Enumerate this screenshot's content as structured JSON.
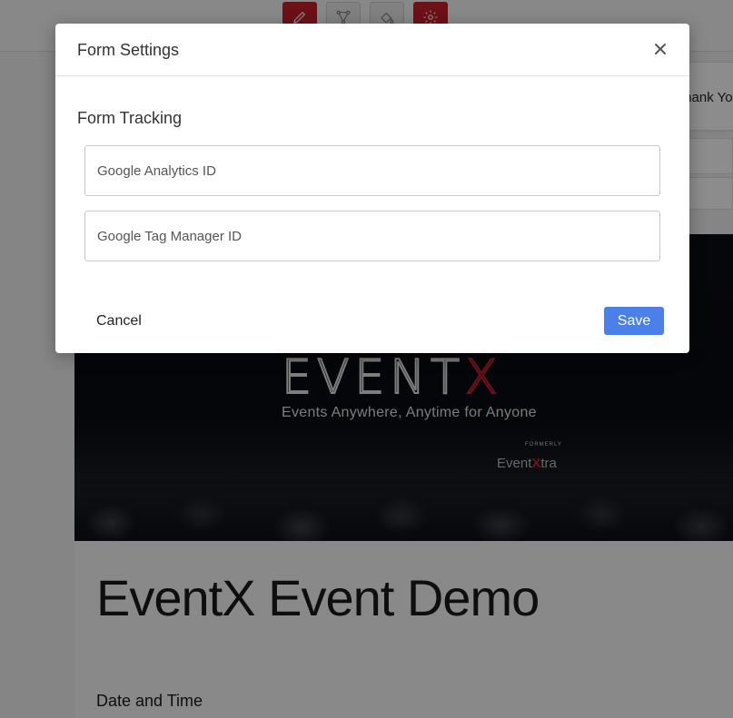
{
  "toolbar": {
    "tools": [
      {
        "icon": "pencil-icon",
        "active": true
      },
      {
        "icon": "flow-icon",
        "active": false
      },
      {
        "icon": "paint-bucket-icon",
        "active": false
      },
      {
        "icon": "gear-icon",
        "active": true
      }
    ],
    "accent_color": "#c4202b"
  },
  "side_tab": {
    "label": "Thank You"
  },
  "banner": {
    "logo_text": "EVENTX",
    "tagline": "Events Anywhere, Anytime for Anyone",
    "formerly_label": "FORMERLY",
    "formerly_logo": "EventXtra"
  },
  "page": {
    "event_title": "EventX Event Demo",
    "date_label": "Date and Time"
  },
  "modal": {
    "title": "Form Settings",
    "section_title": "Form Tracking",
    "fields": {
      "google_analytics": {
        "placeholder": "Google Analytics ID",
        "value": ""
      },
      "google_tag_manager": {
        "placeholder": "Google Tag Manager ID",
        "value": ""
      }
    },
    "cancel_label": "Cancel",
    "save_label": "Save",
    "save_color": "#4a80e8"
  }
}
